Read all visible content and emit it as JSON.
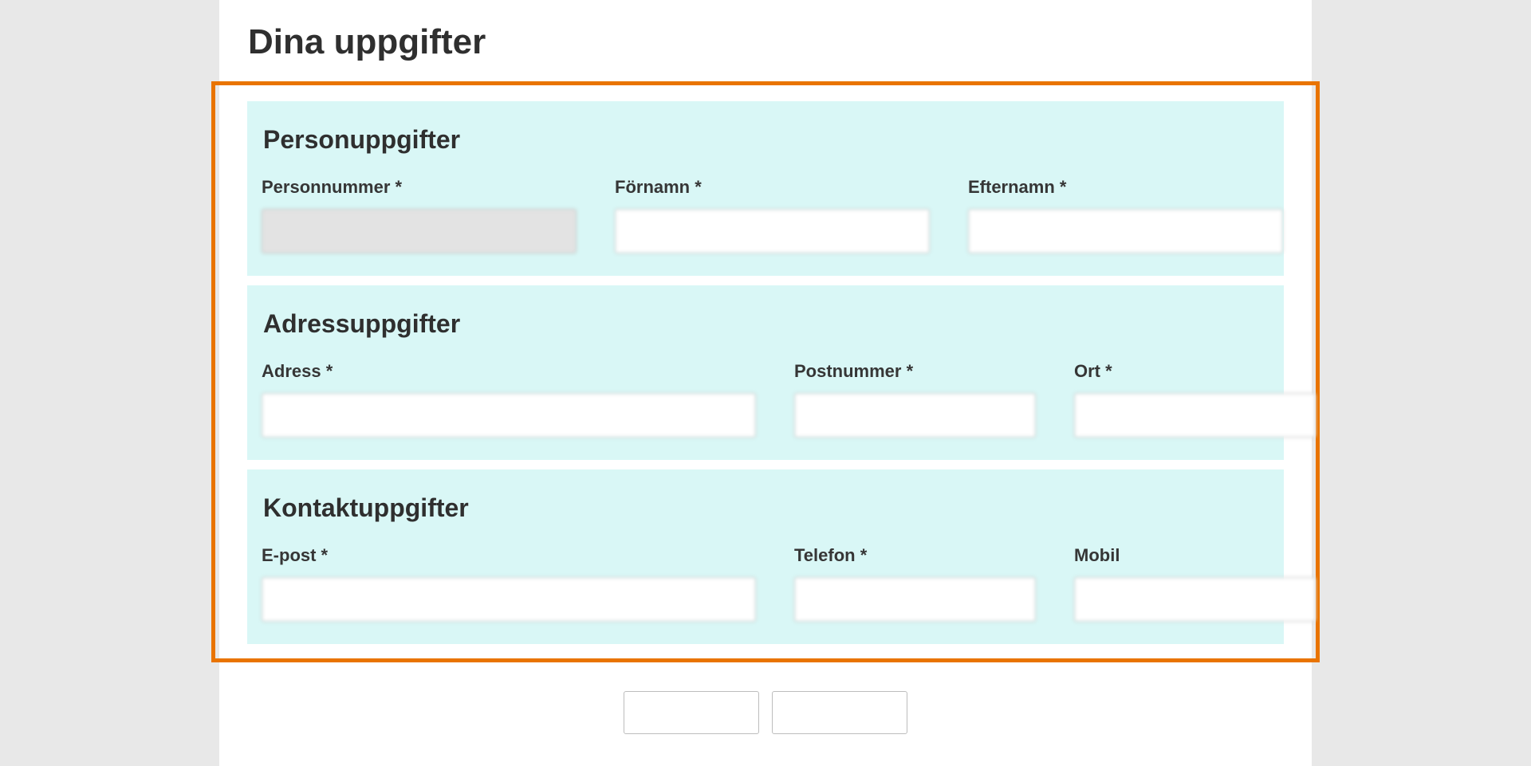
{
  "page": {
    "title": "Dina uppgifter"
  },
  "sections": {
    "person": {
      "title": "Personuppgifter",
      "fields": {
        "personnummer": {
          "label": "Personnummer *",
          "value": ""
        },
        "fornamn": {
          "label": "Förnamn *",
          "value": ""
        },
        "efternamn": {
          "label": "Efternamn *",
          "value": ""
        }
      }
    },
    "adress": {
      "title": "Adressuppgifter",
      "fields": {
        "adress": {
          "label": "Adress *",
          "value": ""
        },
        "postnummer": {
          "label": "Postnummer *",
          "value": ""
        },
        "ort": {
          "label": "Ort *",
          "value": ""
        }
      }
    },
    "kontakt": {
      "title": "Kontaktuppgifter",
      "fields": {
        "epost": {
          "label": "E-post *",
          "value": ""
        },
        "telefon": {
          "label": "Telefon *",
          "value": ""
        },
        "mobil": {
          "label": "Mobil",
          "value": ""
        }
      }
    }
  }
}
